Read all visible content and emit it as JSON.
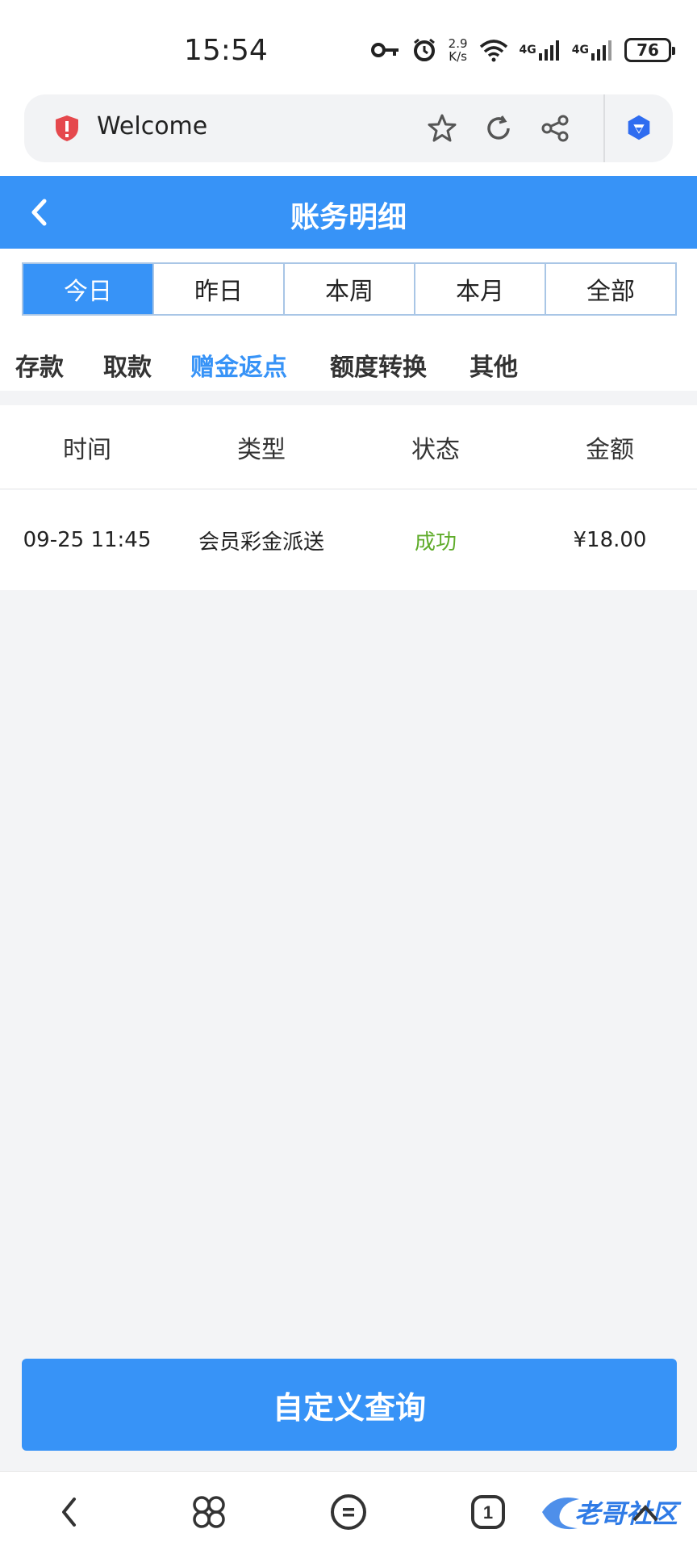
{
  "status_bar": {
    "time": "15:54",
    "speed_value": "2.9",
    "speed_unit": "K/s",
    "sim1_label": "4G",
    "sim2_label": "4G",
    "battery": "76",
    "icons": [
      "key-icon",
      "alarm-icon",
      "wifi-icon",
      "signal-icon",
      "signal-icon",
      "battery-icon"
    ]
  },
  "browser": {
    "url_text": "Welcome",
    "icons": [
      "shield-icon",
      "star-icon",
      "reload-icon",
      "share-icon",
      "ai-assistant-icon"
    ]
  },
  "header": {
    "title": "账务明细",
    "back_icon": "chevron-left-icon"
  },
  "date_tabs": [
    {
      "label": "今日",
      "active": true
    },
    {
      "label": "昨日",
      "active": false
    },
    {
      "label": "本周",
      "active": false
    },
    {
      "label": "本月",
      "active": false
    },
    {
      "label": "全部",
      "active": false
    }
  ],
  "category_tabs": [
    {
      "label": "存款",
      "active": false
    },
    {
      "label": "取款",
      "active": false
    },
    {
      "label": "赠金返点",
      "active": true
    },
    {
      "label": "额度转换",
      "active": false
    },
    {
      "label": "其他",
      "active": false
    }
  ],
  "table": {
    "columns": [
      "时间",
      "类型",
      "状态",
      "金额"
    ],
    "rows": [
      {
        "time": "09-25 11:45",
        "type": "会员彩金派送",
        "status": "成功",
        "amount": "¥18.00"
      }
    ]
  },
  "query_button": {
    "label": "自定义查询"
  },
  "bottom_nav": {
    "tab_count": "1",
    "watermark": "老哥社区",
    "icons": [
      "back-icon",
      "apps-icon",
      "menu-icon",
      "tabs-icon",
      "home-icon"
    ]
  },
  "colors": {
    "primary": "#3793f7",
    "success": "#5fac2a",
    "background": "#f3f4f6"
  }
}
